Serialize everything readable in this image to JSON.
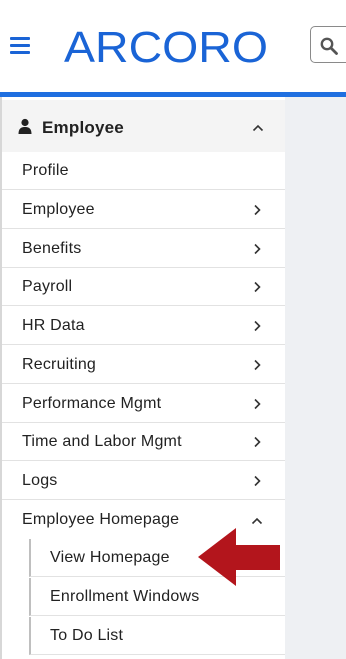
{
  "header": {
    "brand": "ARCORO",
    "brand_color": "#1a64d6",
    "menu_icon": "hamburger-icon",
    "search_icon": "search-icon"
  },
  "sidebar": {
    "section_title": "Employee",
    "section_icon": "user-icon",
    "items": [
      {
        "label": "Profile"
      },
      {
        "label": "Employee"
      },
      {
        "label": "Benefits"
      },
      {
        "label": "Payroll"
      },
      {
        "label": "HR Data"
      },
      {
        "label": "Recruiting"
      },
      {
        "label": "Performance Mgmt"
      },
      {
        "label": "Time and Labor Mgmt"
      },
      {
        "label": "Logs"
      },
      {
        "label": "Employee Homepage"
      }
    ],
    "subitems": [
      {
        "label": "View Homepage"
      },
      {
        "label": "Enrollment Windows"
      },
      {
        "label": "To Do List"
      }
    ]
  },
  "annotation": {
    "arrow_color": "#b3151c",
    "arrow_icon": "pointer-arrow-icon"
  },
  "colors": {
    "accent": "#1f6fe0",
    "content_background": "#eef0f3"
  }
}
